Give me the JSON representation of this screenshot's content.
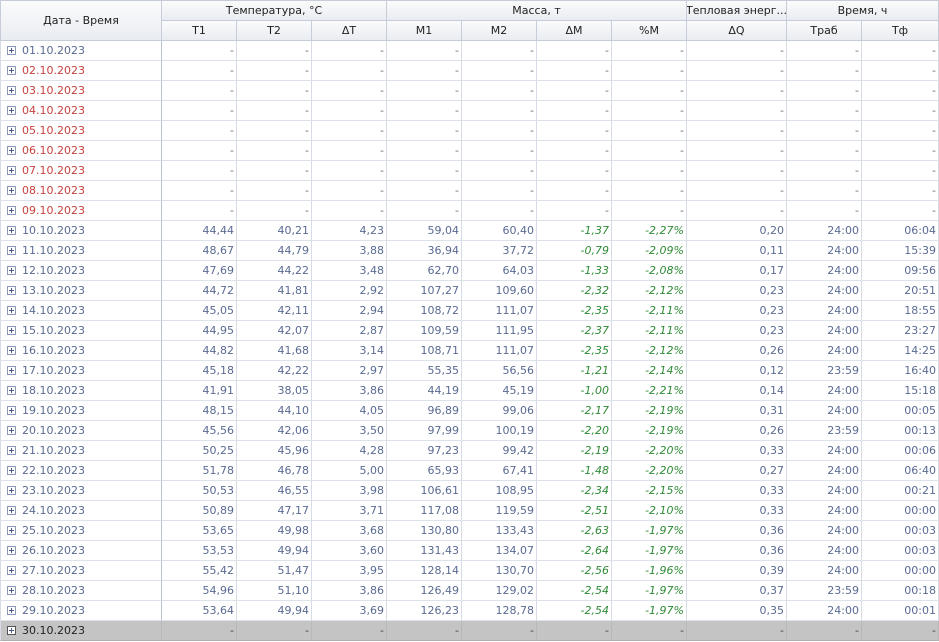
{
  "headers": {
    "date": "Дата - Время",
    "groups": [
      {
        "label": "Температура, °C"
      },
      {
        "label": "Масса, т"
      },
      {
        "label": "Тепловая энерг..."
      },
      {
        "label": "Время, ч"
      }
    ],
    "columns": [
      "T1",
      "T2",
      "ΔT",
      "M1",
      "M2",
      "ΔM",
      "%M",
      "ΔQ",
      "Tраб",
      "Tф"
    ]
  },
  "colors": {
    "weekend_date": "#c8423e",
    "weekday_date": "#5a6a92",
    "negative_value": "#2f8a36",
    "selected_row": "#c4c4c4"
  },
  "rows": [
    {
      "date": "01.10.2023",
      "weekend": false,
      "v": [
        "-",
        "-",
        "-",
        "-",
        "-",
        "-",
        "-",
        "-",
        "-",
        "-"
      ]
    },
    {
      "date": "02.10.2023",
      "weekend": true,
      "v": [
        "-",
        "-",
        "-",
        "-",
        "-",
        "-",
        "-",
        "-",
        "-",
        "-"
      ]
    },
    {
      "date": "03.10.2023",
      "weekend": true,
      "v": [
        "-",
        "-",
        "-",
        "-",
        "-",
        "-",
        "-",
        "-",
        "-",
        "-"
      ]
    },
    {
      "date": "04.10.2023",
      "weekend": true,
      "v": [
        "-",
        "-",
        "-",
        "-",
        "-",
        "-",
        "-",
        "-",
        "-",
        "-"
      ]
    },
    {
      "date": "05.10.2023",
      "weekend": true,
      "v": [
        "-",
        "-",
        "-",
        "-",
        "-",
        "-",
        "-",
        "-",
        "-",
        "-"
      ]
    },
    {
      "date": "06.10.2023",
      "weekend": true,
      "v": [
        "-",
        "-",
        "-",
        "-",
        "-",
        "-",
        "-",
        "-",
        "-",
        "-"
      ]
    },
    {
      "date": "07.10.2023",
      "weekend": true,
      "v": [
        "-",
        "-",
        "-",
        "-",
        "-",
        "-",
        "-",
        "-",
        "-",
        "-"
      ]
    },
    {
      "date": "08.10.2023",
      "weekend": true,
      "v": [
        "-",
        "-",
        "-",
        "-",
        "-",
        "-",
        "-",
        "-",
        "-",
        "-"
      ]
    },
    {
      "date": "09.10.2023",
      "weekend": true,
      "v": [
        "-",
        "-",
        "-",
        "-",
        "-",
        "-",
        "-",
        "-",
        "-",
        "-"
      ]
    },
    {
      "date": "10.10.2023",
      "weekend": false,
      "v": [
        "44,44",
        "40,21",
        "4,23",
        "59,04",
        "60,40",
        "-1,37",
        "-2,27%",
        "0,20",
        "24:00",
        "06:04"
      ]
    },
    {
      "date": "11.10.2023",
      "weekend": false,
      "v": [
        "48,67",
        "44,79",
        "3,88",
        "36,94",
        "37,72",
        "-0,79",
        "-2,09%",
        "0,11",
        "24:00",
        "15:39"
      ]
    },
    {
      "date": "12.10.2023",
      "weekend": false,
      "v": [
        "47,69",
        "44,22",
        "3,48",
        "62,70",
        "64,03",
        "-1,33",
        "-2,08%",
        "0,17",
        "24:00",
        "09:56"
      ]
    },
    {
      "date": "13.10.2023",
      "weekend": false,
      "v": [
        "44,72",
        "41,81",
        "2,92",
        "107,27",
        "109,60",
        "-2,32",
        "-2,12%",
        "0,23",
        "24:00",
        "20:51"
      ]
    },
    {
      "date": "14.10.2023",
      "weekend": false,
      "v": [
        "45,05",
        "42,11",
        "2,94",
        "108,72",
        "111,07",
        "-2,35",
        "-2,11%",
        "0,23",
        "24:00",
        "18:55"
      ]
    },
    {
      "date": "15.10.2023",
      "weekend": false,
      "v": [
        "44,95",
        "42,07",
        "2,87",
        "109,59",
        "111,95",
        "-2,37",
        "-2,11%",
        "0,23",
        "24:00",
        "23:27"
      ]
    },
    {
      "date": "16.10.2023",
      "weekend": false,
      "v": [
        "44,82",
        "41,68",
        "3,14",
        "108,71",
        "111,07",
        "-2,35",
        "-2,12%",
        "0,26",
        "24:00",
        "14:25"
      ]
    },
    {
      "date": "17.10.2023",
      "weekend": false,
      "v": [
        "45,18",
        "42,22",
        "2,97",
        "55,35",
        "56,56",
        "-1,21",
        "-2,14%",
        "0,12",
        "23:59",
        "16:40"
      ]
    },
    {
      "date": "18.10.2023",
      "weekend": false,
      "v": [
        "41,91",
        "38,05",
        "3,86",
        "44,19",
        "45,19",
        "-1,00",
        "-2,21%",
        "0,14",
        "24:00",
        "15:18"
      ]
    },
    {
      "date": "19.10.2023",
      "weekend": false,
      "v": [
        "48,15",
        "44,10",
        "4,05",
        "96,89",
        "99,06",
        "-2,17",
        "-2,19%",
        "0,31",
        "24:00",
        "00:05"
      ]
    },
    {
      "date": "20.10.2023",
      "weekend": false,
      "v": [
        "45,56",
        "42,06",
        "3,50",
        "97,99",
        "100,19",
        "-2,20",
        "-2,19%",
        "0,26",
        "23:59",
        "00:13"
      ]
    },
    {
      "date": "21.10.2023",
      "weekend": false,
      "v": [
        "50,25",
        "45,96",
        "4,28",
        "97,23",
        "99,42",
        "-2,19",
        "-2,20%",
        "0,33",
        "24:00",
        "00:06"
      ]
    },
    {
      "date": "22.10.2023",
      "weekend": false,
      "v": [
        "51,78",
        "46,78",
        "5,00",
        "65,93",
        "67,41",
        "-1,48",
        "-2,20%",
        "0,27",
        "24:00",
        "06:40"
      ]
    },
    {
      "date": "23.10.2023",
      "weekend": false,
      "v": [
        "50,53",
        "46,55",
        "3,98",
        "106,61",
        "108,95",
        "-2,34",
        "-2,15%",
        "0,33",
        "24:00",
        "00:21"
      ]
    },
    {
      "date": "24.10.2023",
      "weekend": false,
      "v": [
        "50,89",
        "47,17",
        "3,71",
        "117,08",
        "119,59",
        "-2,51",
        "-2,10%",
        "0,33",
        "24:00",
        "00:00"
      ]
    },
    {
      "date": "25.10.2023",
      "weekend": false,
      "v": [
        "53,65",
        "49,98",
        "3,68",
        "130,80",
        "133,43",
        "-2,63",
        "-1,97%",
        "0,36",
        "24:00",
        "00:03"
      ]
    },
    {
      "date": "26.10.2023",
      "weekend": false,
      "v": [
        "53,53",
        "49,94",
        "3,60",
        "131,43",
        "134,07",
        "-2,64",
        "-1,97%",
        "0,36",
        "24:00",
        "00:03"
      ]
    },
    {
      "date": "27.10.2023",
      "weekend": false,
      "v": [
        "55,42",
        "51,47",
        "3,95",
        "128,14",
        "130,70",
        "-2,56",
        "-1,96%",
        "0,39",
        "24:00",
        "00:00"
      ]
    },
    {
      "date": "28.10.2023",
      "weekend": false,
      "v": [
        "54,96",
        "51,10",
        "3,86",
        "126,49",
        "129,02",
        "-2,54",
        "-1,97%",
        "0,37",
        "23:59",
        "00:18"
      ]
    },
    {
      "date": "29.10.2023",
      "weekend": false,
      "v": [
        "53,64",
        "49,94",
        "3,69",
        "126,23",
        "128,78",
        "-2,54",
        "-1,97%",
        "0,35",
        "24:00",
        "00:01"
      ]
    },
    {
      "date": "30.10.2023",
      "weekend": false,
      "selected": true,
      "v": [
        "-",
        "-",
        "-",
        "-",
        "-",
        "-",
        "-",
        "-",
        "-",
        "-"
      ]
    }
  ]
}
